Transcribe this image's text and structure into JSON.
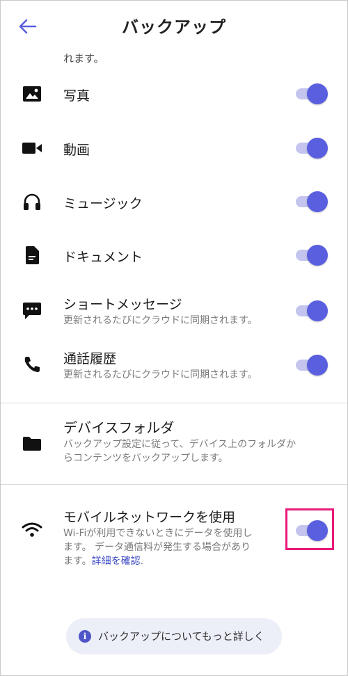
{
  "header": {
    "title": "バックアップ"
  },
  "truncated_text": "れます。",
  "items": [
    {
      "label": "写真",
      "icon": "image-icon",
      "enabled": true
    },
    {
      "label": "動画",
      "icon": "video-camera-icon",
      "enabled": true
    },
    {
      "label": "ミュージック",
      "icon": "headphones-icon",
      "enabled": true
    },
    {
      "label": "ドキュメント",
      "icon": "document-icon",
      "enabled": true
    },
    {
      "label": "ショートメッセージ",
      "sub": "更新されるたびにクラウドに同期されます。",
      "icon": "message-icon",
      "enabled": true
    },
    {
      "label": "通話履歴",
      "sub": "更新されるたびにクラウドに同期されます。",
      "icon": "phone-icon",
      "enabled": true
    }
  ],
  "device_folder": {
    "title": "デバイスフォルダ",
    "desc_line1": "バックアップ設定に従って、デバイス上のフォルダか",
    "desc_line2": "らコンテンツをバックアップします。"
  },
  "mobile_network": {
    "title": "モバイルネットワークを使用",
    "desc_line1": "Wi-Fiが利用できないときにデータを使用し",
    "desc_line2": "ます。 データ通信料が発生する場合があり",
    "desc_line3_prefix": "ます。",
    "desc_link": "詳細を確認",
    "desc_line3_suffix": ".",
    "enabled": true
  },
  "footer": {
    "info_button": "バックアップについてもっと詳しく"
  },
  "colors": {
    "accent": "#5a5fe0",
    "track": "#c3c5ef",
    "highlight": "#e8197a"
  }
}
